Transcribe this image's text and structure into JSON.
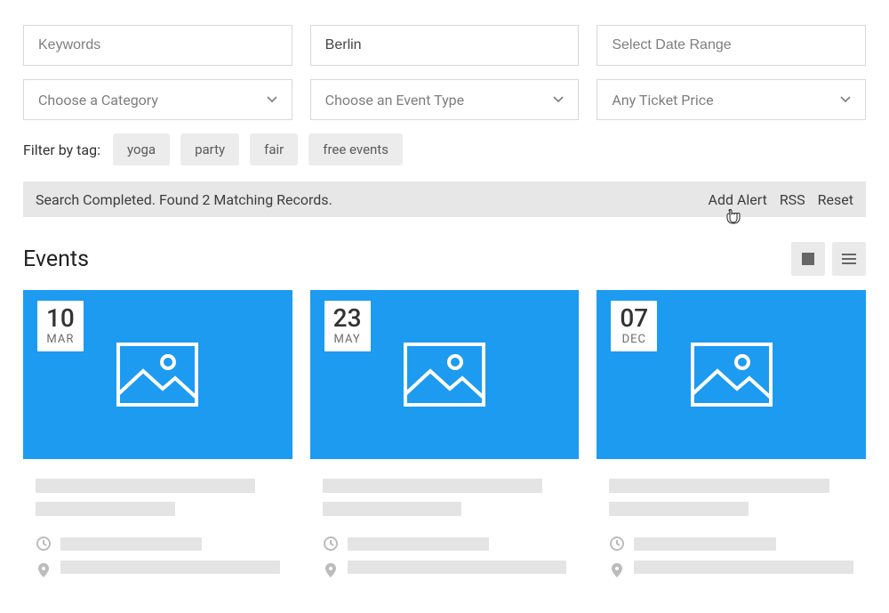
{
  "filters": {
    "keywords_placeholder": "Keywords",
    "keywords_value": "",
    "location_value": "Berlin",
    "daterange_placeholder": "Select Date Range",
    "daterange_value": "",
    "category_label": "Choose a Category",
    "eventtype_label": "Choose an Event Type",
    "ticketprice_label": "Any Ticket Price"
  },
  "tagfilter": {
    "label": "Filter by tag:",
    "tags": [
      "yoga",
      "party",
      "fair",
      "free events"
    ]
  },
  "status": {
    "message": "Search Completed. Found 2 Matching Records.",
    "actions": {
      "add_alert": "Add Alert",
      "rss": "RSS",
      "reset": "Reset"
    }
  },
  "section": {
    "title": "Events"
  },
  "cards": [
    {
      "day": "10",
      "month": "MAR"
    },
    {
      "day": "23",
      "month": "MAY"
    },
    {
      "day": "07",
      "month": "DEC"
    }
  ],
  "icons": {
    "chevron_down": "chevron-down-icon",
    "image_placeholder": "image-placeholder-icon",
    "clock": "clock-icon",
    "pin": "map-pin-icon",
    "grid": "grid-view-icon",
    "list": "list-view-icon"
  },
  "colors": {
    "accent": "#1d9bf0",
    "panel": "#e7e7e7",
    "border": "#d9d9d9"
  }
}
